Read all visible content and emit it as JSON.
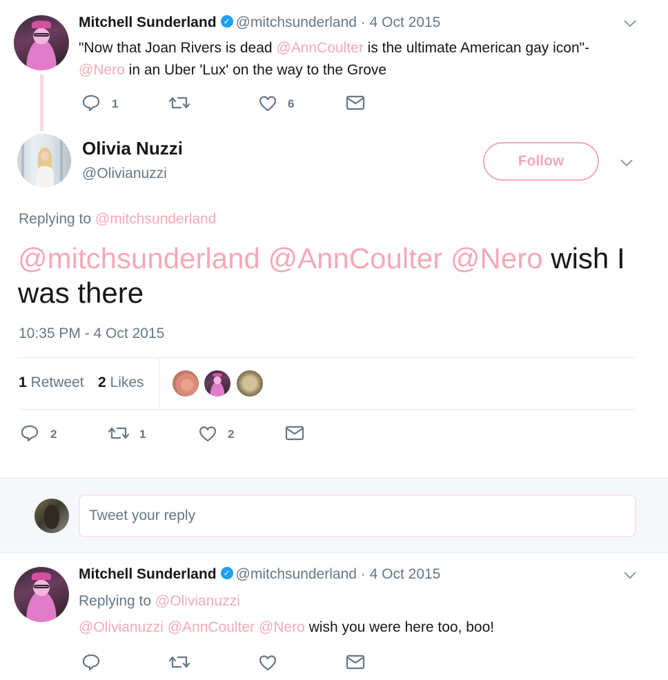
{
  "tweet1": {
    "name": "Mitchell Sunderland",
    "handle": "@mitchsunderland",
    "sep": "·",
    "date": "4 Oct 2015",
    "text_part1": "\"Now that Joan Rivers is dead ",
    "mention1": "@AnnCoulter",
    "text_part2": " is the ultimate American gay icon\"-",
    "mention2": "@Nero",
    "text_part3": " in an Uber 'Lux' on the way to the Grove",
    "reply_count": "1",
    "like_count": "6"
  },
  "main": {
    "name": "Olivia Nuzzi",
    "handle": "@Olivianuzzi",
    "follow_label": "Follow",
    "replying_label": "Replying to",
    "replying_to": "@mitchsunderland",
    "mention1": "@mitchsunderland",
    "mention2": "@AnnCoulter",
    "mention3": "@Nero",
    "text": " wish I was there",
    "timestamp": "10:35 PM - 4 Oct 2015",
    "retweet_num": "1",
    "retweet_label": "Retweet",
    "likes_num": "2",
    "likes_label": "Likes",
    "reply_count": "2",
    "retweet_count": "1",
    "like_count": "2"
  },
  "reply_input": {
    "placeholder": "Tweet your reply"
  },
  "tweet3": {
    "name": "Mitchell Sunderland",
    "handle": "@mitchsunderland",
    "sep": "·",
    "date": "4 Oct 2015",
    "replying_label": "Replying to",
    "replying_to": "@Olivianuzzi",
    "mention1": "@Olivianuzzi",
    "mention2": "@AnnCoulter",
    "mention3": "@Nero",
    "text": " wish you were here too, boo!"
  },
  "icons": {
    "reply": "speech-bubble-icon",
    "retweet": "retweet-icon",
    "like": "heart-icon",
    "dm": "envelope-icon",
    "caret": "chevron-down-icon",
    "verified": "verified-badge-icon"
  },
  "colors": {
    "accent": "#f4a9b8",
    "muted": "#657786",
    "verified": "#1da1f2",
    "divider": "#e6ecf0"
  }
}
